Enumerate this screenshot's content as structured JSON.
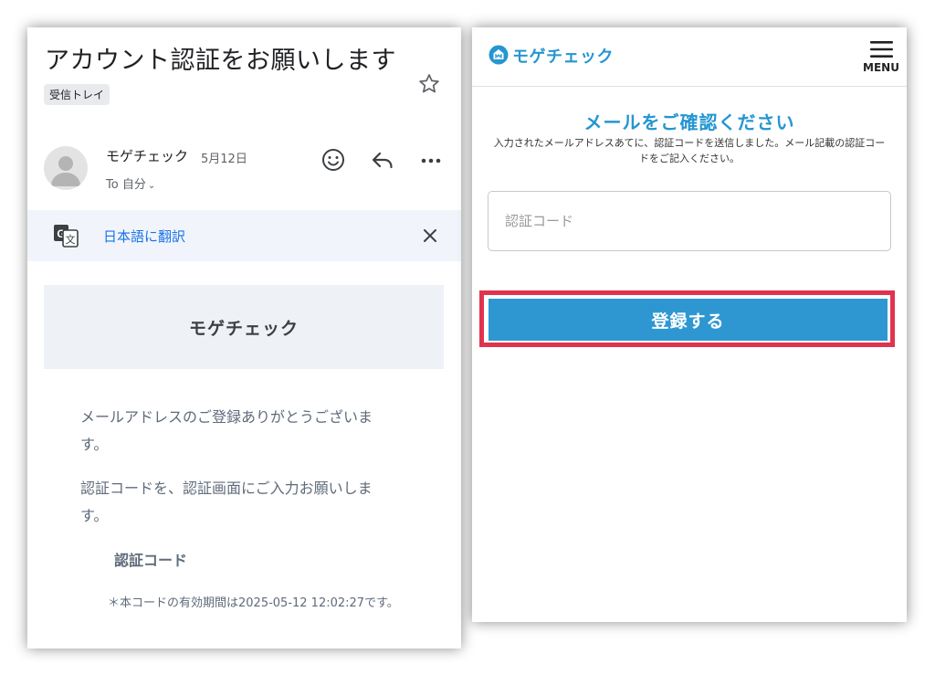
{
  "email": {
    "subject": "アカウント認証をお願いします",
    "label": "受信トレイ",
    "sender": {
      "name": "モゲチェック",
      "date": "5月12日",
      "recipient": "To 自分"
    },
    "translate": {
      "link": "日本語に翻訳"
    },
    "body": {
      "banner": "モゲチェック",
      "paragraph_1": "メールアドレスのご登録ありがとうございます。",
      "paragraph_2": "認証コードを、認証画面にご入力お願いします。",
      "code_heading": "認証コード",
      "expiry": "＊本コードの有効期間は2025-05-12 12:02:27です。"
    },
    "icons": {
      "star": "star-icon",
      "avatar": "person-icon",
      "emoji": "smiley-icon",
      "reply": "reply-icon",
      "more": "more-horizontal-icon",
      "translate": "google-translate-icon",
      "close": "close-icon"
    }
  },
  "site": {
    "brand": "モゲチェック",
    "menu_label": "MENU",
    "title": "メールをご確認ください",
    "description": "入力されたメールアドレスあてに、認証コードを送信しました。メール記載の認証コードをご記入ください。",
    "code_input": {
      "placeholder": "認証コード",
      "value": ""
    },
    "register_button": "登録する",
    "colors": {
      "brand": "#2596d1",
      "button": "#2e97d2",
      "highlight": "#e0334f"
    }
  }
}
